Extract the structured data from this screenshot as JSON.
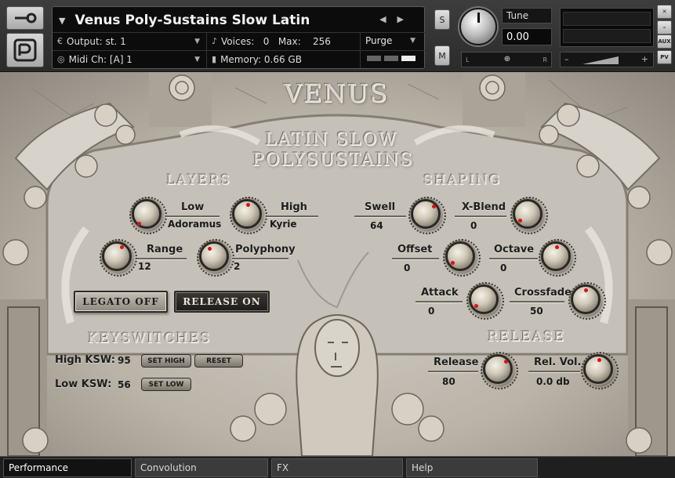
{
  "header": {
    "instrument_name": "Venus Poly-Sustains Slow Latin",
    "output_label": "Output:",
    "output_value": "st. 1",
    "voices_label": "Voices:",
    "voices_value": "0",
    "max_label": "Max:",
    "max_value": "256",
    "purge_label": "Purge",
    "midi_label": "Midi Ch:",
    "midi_value": "[A]  1",
    "memory_label": "Memory:",
    "memory_value": "0.66 GB",
    "solo_label": "S",
    "mute_label": "M",
    "tune_label": "Tune",
    "tune_value": "0.00",
    "pan_left": "L",
    "pan_right": "R",
    "vol_minus": "–",
    "vol_plus": "+",
    "aux_label": "AUX",
    "pv_label": "PV"
  },
  "panel": {
    "brand": "VENUS",
    "subtitle_line1": "LATIN SLOW",
    "subtitle_line2": "POLYSUSTAINS",
    "layers_title": "LAYERS",
    "shaping_title": "SHAPING",
    "keyswitches_title": "KEYSWITCHES",
    "release_title": "RELEASE"
  },
  "layers": {
    "low_label": "Low",
    "low_value": "Adoramus",
    "high_label": "High",
    "high_value": "Kyrie",
    "range_label": "Range",
    "range_value": "12",
    "polyphony_label": "Polyphony",
    "polyphony_value": "2"
  },
  "buttons": {
    "legato": "LEGATO OFF",
    "release": "RELEASE ON"
  },
  "shaping": {
    "swell_label": "Swell",
    "swell_value": "64",
    "xblend_label": "X-Blend",
    "xblend_value": "0",
    "offset_label": "Offset",
    "offset_value": "0",
    "octave_label": "Octave",
    "octave_value": "0",
    "attack_label": "Attack",
    "attack_value": "0",
    "crossfade_label": "Crossfade",
    "crossfade_value": "50"
  },
  "keyswitches": {
    "high_label": "High KSW:",
    "high_value": "95",
    "low_label": "Low KSW:",
    "low_value": "56",
    "set_high": "SET HIGH",
    "reset": "RESET",
    "set_low": "SET LOW"
  },
  "release": {
    "release_label": "Release",
    "release_value": "80",
    "relvol_label": "Rel. Vol.",
    "relvol_value": "0.0 db"
  },
  "tabs": [
    "Performance",
    "Convolution",
    "FX",
    "Help"
  ],
  "colors": {
    "stone": "#bdb7ac",
    "knob_indicator": "#dd1111",
    "header_bg": "#0c0c0c"
  },
  "icons": {
    "tool": "wrench-icon",
    "logo": "dp-logo-icon",
    "output": "output-icon",
    "midi": "midi-icon",
    "voices": "voices-icon",
    "memory": "memory-icon"
  }
}
